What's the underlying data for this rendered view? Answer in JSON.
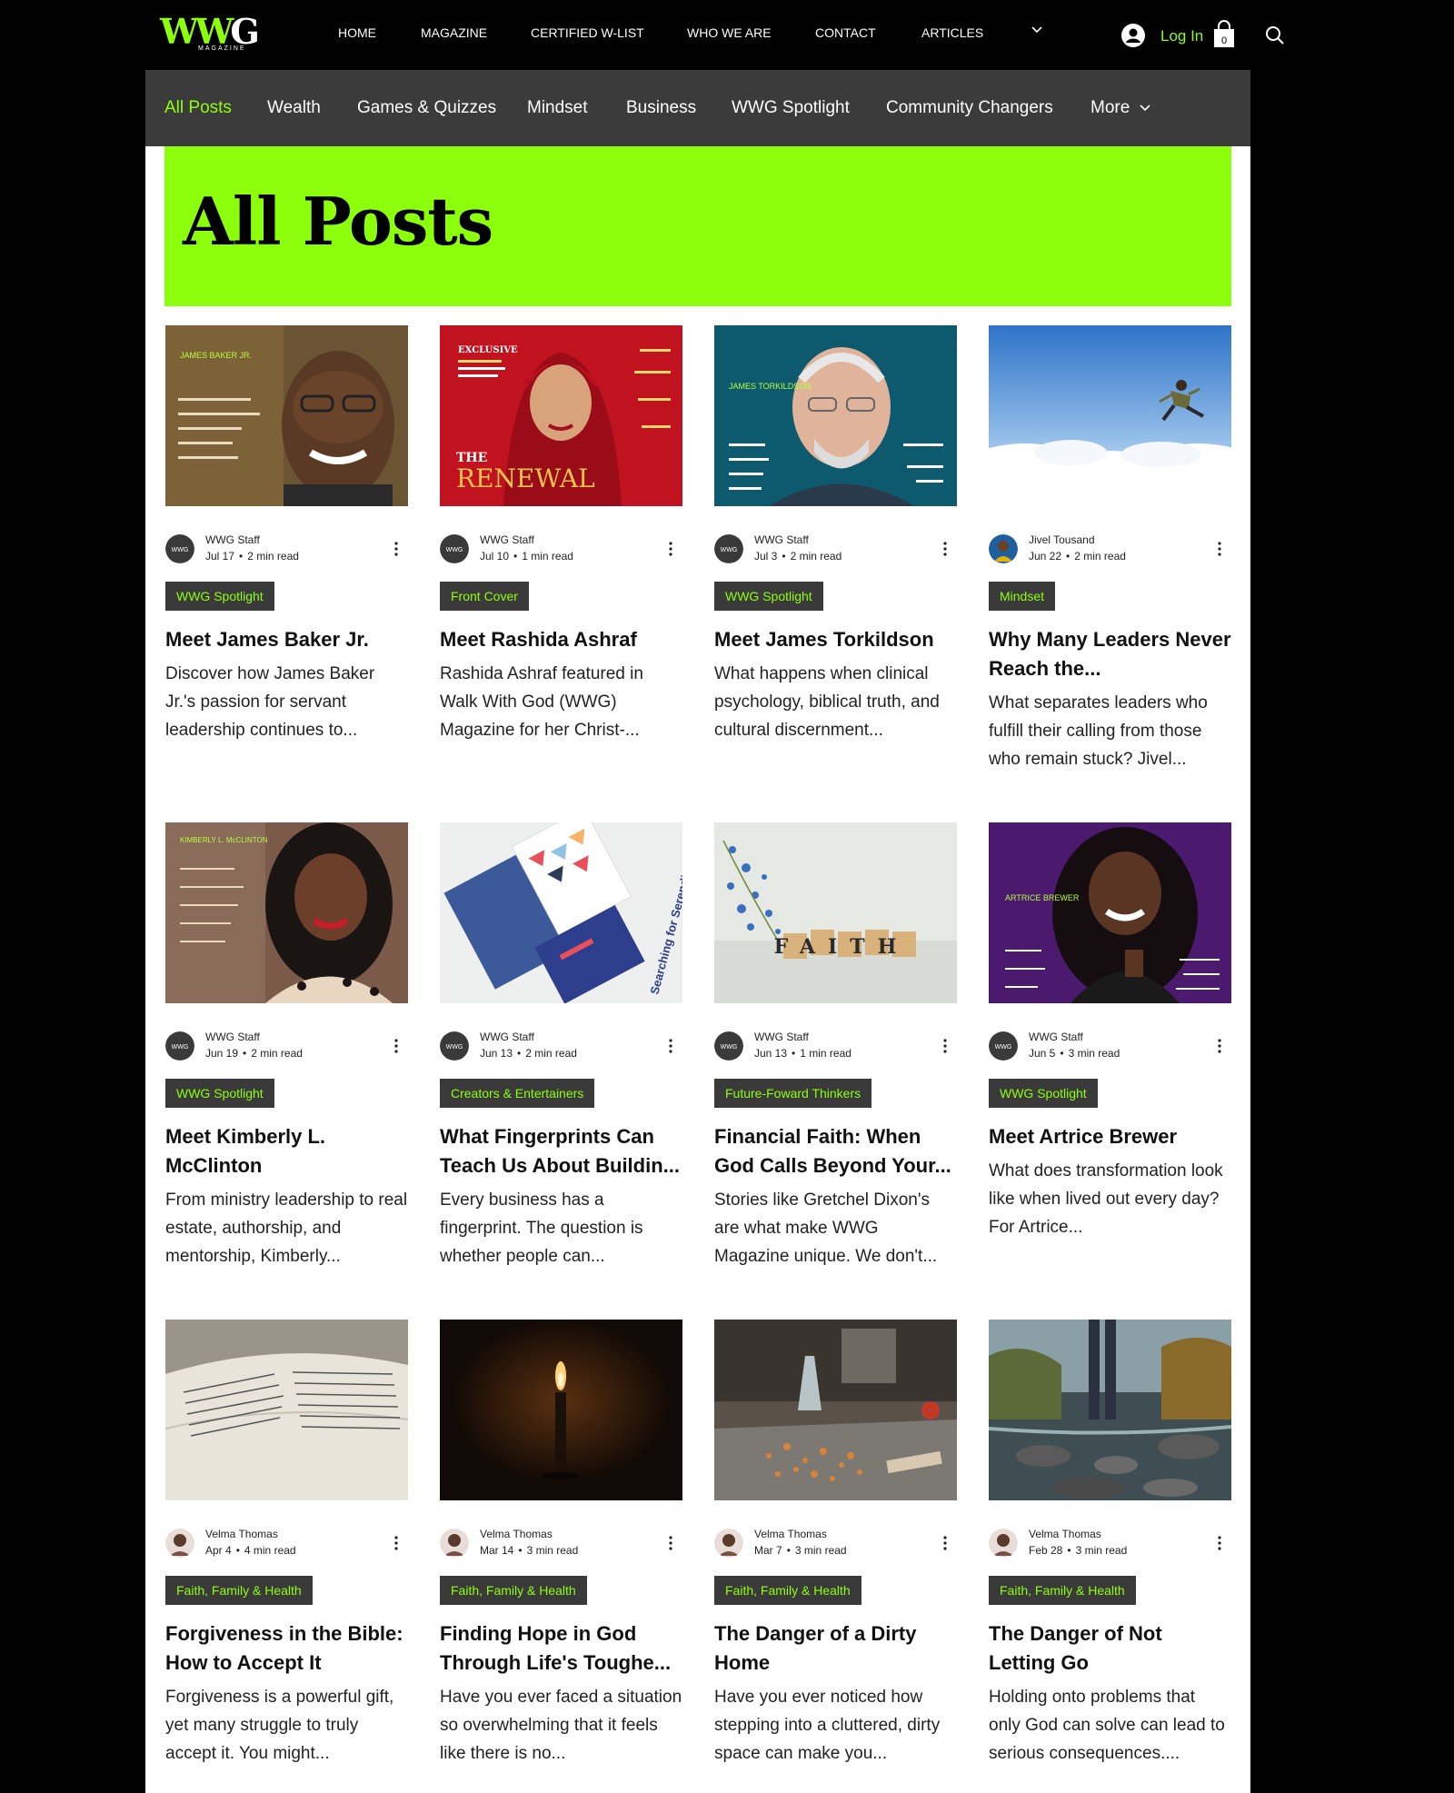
{
  "header": {
    "logo_text_main": "WW",
    "logo_text_g": "G",
    "logo_sub": "MAGAZINE",
    "nav": [
      "HOME",
      "MAGAZINE",
      "CERTIFIED W-LIST",
      "WHO WE ARE",
      "CONTACT",
      "ARTICLES"
    ],
    "login_label": "Log In",
    "cart_count": "0"
  },
  "categories": {
    "items": [
      "All Posts",
      "Wealth",
      "Games & Quizzes",
      "Mindset",
      "Business",
      "WWG Spotlight",
      "Community Changers",
      "More"
    ],
    "active": "All Posts"
  },
  "hero": {
    "title": "All Posts"
  },
  "posts": [
    {
      "author": "WWG Staff",
      "date": "Jul 17",
      "read": "2 min read",
      "tag": "WWG Spotlight",
      "title": "Meet James Baker Jr.",
      "excerpt": "Discover how James Baker Jr.'s passion for servant leadership continues to..."
    },
    {
      "author": "WWG Staff",
      "date": "Jul 10",
      "read": "1 min read",
      "tag": "Front Cover",
      "title": "Meet Rashida Ashraf",
      "excerpt": "Rashida Ashraf featured in Walk With God (WWG) Magazine for her Christ-..."
    },
    {
      "author": "WWG Staff",
      "date": "Jul 3",
      "read": "2 min read",
      "tag": "WWG Spotlight",
      "title": "Meet James Torkildson",
      "excerpt": "What happens when clinical psychology, biblical truth, and cultural discernment..."
    },
    {
      "author": "Jivel Tousand",
      "date": "Jun 22",
      "read": "2 min read",
      "tag": "Mindset",
      "title": "Why Many Leaders Never Reach the...",
      "excerpt": "What separates leaders who fulfill their calling from those who remain stuck? Jivel..."
    },
    {
      "author": "WWG Staff",
      "date": "Jun 19",
      "read": "2 min read",
      "tag": "WWG Spotlight",
      "title": "Meet Kimberly L. McClinton",
      "excerpt": "From ministry leadership to real estate, authorship, and mentorship, Kimberly..."
    },
    {
      "author": "WWG Staff",
      "date": "Jun 13",
      "read": "2 min read",
      "tag": "Creators & Entertainers",
      "title": "What Fingerprints Can Teach Us About Buildin...",
      "excerpt": "Every business has a fingerprint. The question is whether people can..."
    },
    {
      "author": "WWG Staff",
      "date": "Jun 13",
      "read": "1 min read",
      "tag": "Future-Foward Thinkers",
      "title": "Financial Faith: When God Calls Beyond Your...",
      "excerpt": "Stories like Gretchel Dixon's are what make WWG Magazine unique. We don't..."
    },
    {
      "author": "WWG Staff",
      "date": "Jun 5",
      "read": "3 min read",
      "tag": "WWG Spotlight",
      "title": "Meet Artrice Brewer",
      "excerpt": "What does transformation look like when lived out every day? For Artrice..."
    },
    {
      "author": "Velma Thomas",
      "date": "Apr 4",
      "read": "4 min read",
      "tag": "Faith, Family & Health",
      "title": "Forgiveness in the Bible: How to Accept It",
      "excerpt": "Forgiveness is a powerful gift, yet many struggle to truly accept it. You might..."
    },
    {
      "author": "Velma Thomas",
      "date": "Mar 14",
      "read": "3 min read",
      "tag": "Faith, Family & Health",
      "title": "Finding Hope in God Through Life's Toughe...",
      "excerpt": "Have you ever faced a situation so overwhelming that it feels like there is no..."
    },
    {
      "author": "Velma Thomas",
      "date": "Mar 7",
      "read": "3 min read",
      "tag": "Faith, Family & Health",
      "title": "The Danger of a Dirty Home",
      "excerpt": "Have you ever noticed how stepping into a cluttered, dirty space can make you..."
    },
    {
      "author": "Velma Thomas",
      "date": "Feb 28",
      "read": "3 min read",
      "tag": "Faith, Family & Health",
      "title": "The Danger of Not Letting Go",
      "excerpt": "Holding onto problems that only God can solve can lead to serious consequences...."
    }
  ],
  "cover_text": {
    "james_baker": "JAMES BAKER JR.",
    "rashida_top": "EXCLUSIVE",
    "rashida_the": "THE",
    "rashida_renewal": "RENEWAL",
    "torkildson": "JAMES TORKILDSON",
    "kimberly": "KIMBERLY L. McCLINTON",
    "artrice": "ARTRICE BREWER",
    "faith": "FAITH",
    "serendipity": "Searching for Serendipity"
  },
  "colors": {
    "accent": "#8cff0d",
    "dark": "#3a3a3a",
    "catbar": "#3b3b3b"
  }
}
